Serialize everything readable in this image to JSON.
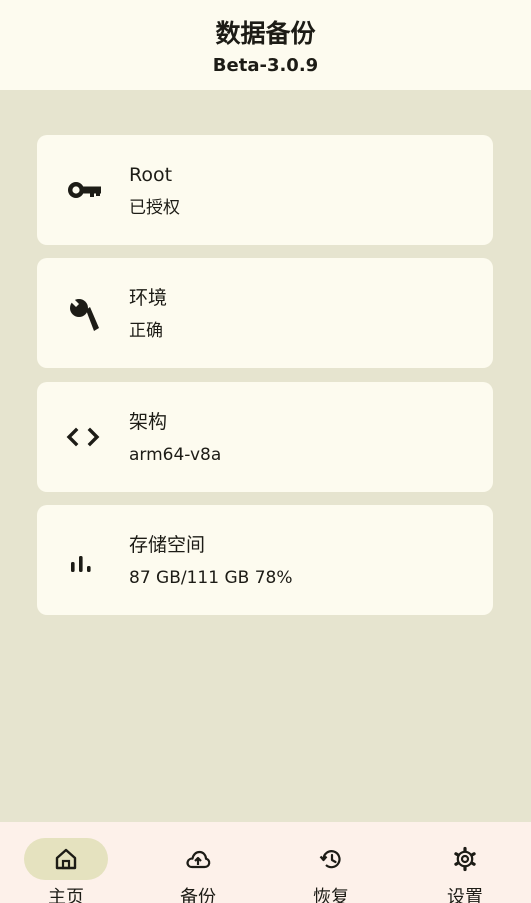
{
  "header": {
    "title": "数据备份",
    "version": "Beta-3.0.9"
  },
  "cards": [
    {
      "icon": "key-icon",
      "title": "Root",
      "value": "已授权"
    },
    {
      "icon": "wrench-icon",
      "title": "环境",
      "value": "正确"
    },
    {
      "icon": "code-icon",
      "title": "架构",
      "value": "arm64-v8a"
    },
    {
      "icon": "bar-chart-icon",
      "title": "存储空间",
      "value": "87 GB/111 GB 78%"
    }
  ],
  "bottom_nav": {
    "active": "主页",
    "items": [
      {
        "icon": "home-icon",
        "label": "主页"
      },
      {
        "icon": "cloud-upload-icon",
        "label": "备份"
      },
      {
        "icon": "history-icon",
        "label": "恢复"
      },
      {
        "icon": "gear-icon",
        "label": "设置"
      }
    ]
  },
  "colors": {
    "background": "#e6e4cf",
    "surface": "#fdfbef",
    "nav_background": "#fdf1ea",
    "nav_active_pill": "#e5e2bf",
    "text": "#1d1c16"
  }
}
